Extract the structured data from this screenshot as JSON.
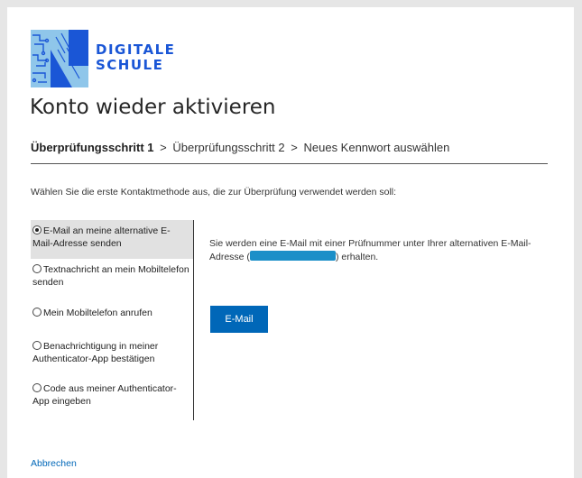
{
  "brand": {
    "line1": "DIGITALE",
    "line2": "SCHULE",
    "color": "#1a56d6"
  },
  "page_title": "Konto wieder aktivieren",
  "steps": {
    "current": "Überprüfungsschritt 1",
    "separator": ">",
    "step2": "Überprüfungsschritt 2",
    "step3": "Neues Kennwort auswählen"
  },
  "instruction": "Wählen Sie die erste Kontaktmethode aus, die zur Überprüfung verwendet werden soll:",
  "methods": [
    {
      "label": "E-Mail an meine alternative E-Mail-Adresse senden",
      "selected": true
    },
    {
      "label": "Textnachricht an mein Mobiltelefon senden",
      "selected": false
    },
    {
      "label": "Mein Mobiltelefon anrufen",
      "selected": false
    },
    {
      "label": "Benachrichtigung in meiner Authenticator-App bestätigen",
      "selected": false
    },
    {
      "label": "Code aus meiner Authenticator-App eingeben",
      "selected": false
    }
  ],
  "detail": {
    "text_before": "Sie werden eine E-Mail mit einer Prüfnummer unter Ihrer alternativen E-Mail-Adresse (",
    "text_after": ") erhalten."
  },
  "email_button_label": "E-Mail",
  "cancel_label": "Abbrechen",
  "colors": {
    "accent": "#0067b8",
    "selected_bg": "#e1e1e1",
    "redaction": "#1b8fc8"
  }
}
